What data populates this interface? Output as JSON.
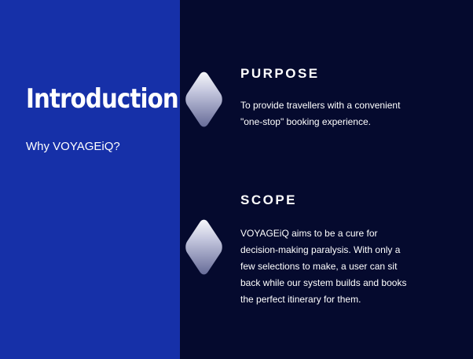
{
  "intro": {
    "title": "Introduction",
    "subtitle": "Why VOYAGEiQ?"
  },
  "sections": [
    {
      "heading": "PURPOSE",
      "text": "To provide travellers with a convenient \"one-stop\" booking experience.",
      "icon": "diamond-icon"
    },
    {
      "heading": "SCOPE",
      "text": "VOYAGEiQ aims to be a cure for decision-making paralysis. With only a few selections to make, a user can sit back while our system builds and books the perfect itinerary for them.",
      "icon": "diamond-icon"
    }
  ],
  "colors": {
    "left_panel": "#1630a8",
    "right_panel": "#050a2e",
    "text": "#ffffff"
  }
}
